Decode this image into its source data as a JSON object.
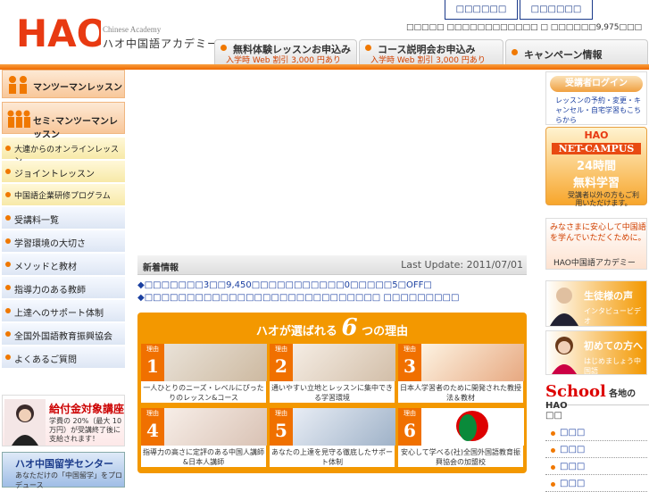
{
  "header": {
    "logo_text": "HAO",
    "logo_en": "Chinese Academy",
    "logo_ja": "ハオ中国語アカデミー",
    "top_tabs": [
      "□□□□□□",
      "□□□□□□"
    ],
    "top_info": "□□□□□ □□□□□□□□□□□□ □ □□□□□□9,975□□□",
    "nav": [
      {
        "title": "無料体験レッスンお申込み",
        "sub": "入学時 Web 割引 3,000 円あり"
      },
      {
        "title": "コース説明会お申込み",
        "sub": "入学時 Web 割引 3,000 円あり"
      },
      {
        "title": "キャンペーン情報",
        "sub": ""
      }
    ]
  },
  "sidebar": {
    "items": [
      "マンツーマンレッスン",
      "セミ･マンツーマンレッスン",
      "大連からのオンラインレッスン",
      "ジョイントレッスン",
      "中国語企業研修プログラム",
      "受講料一覧",
      "学習環境の大切さ",
      "メソッドと教材",
      "指導力のある教師",
      "上達へのサポート体制",
      "全国外国語教育振興協会",
      "よくあるご質問"
    ],
    "banner1_title": "給付金対象講座",
    "banner1_sub": "学費の 20%（最大 10万円）が受講終了後に支給されます！",
    "banner2_title": "ハオ中国留学センター",
    "banner2_sub": "あなただけの「中国留学」をプロデュース"
  },
  "main": {
    "news_title": "新着情報",
    "news_date": "Last Update: 2011/07/01",
    "news": [
      "◆□□□□□□□3□□9,450□□□□□□□□□□□0□□□□□5□OFF□",
      "◆□□□□□□□□□□□□□□□□□□□□□□□□□□□□ □□□□□□□□□"
    ],
    "reasons_title": "ハオが選ばれる",
    "reasons_num": "6",
    "reasons_suffix": "つの理由",
    "reason_label": "理由",
    "reasons": [
      {
        "n": "1",
        "caption": "一人ひとりのニーズ・レベルにぴったりのレッスン&コース"
      },
      {
        "n": "2",
        "caption": "通いやすい立地とレッスンに集中できる学習環境"
      },
      {
        "n": "3",
        "caption": "日本人学習者のために開発された教授法＆教材"
      },
      {
        "n": "4",
        "caption": "指導力の高さに定評のある中国人講師&日本人講師"
      },
      {
        "n": "5",
        "caption": "あなたの上達を見守る徹底したサポート体制"
      },
      {
        "n": "6",
        "caption": "安心して学べる(社)全国外国語教育振興協会の加盟校"
      }
    ]
  },
  "right": {
    "login_title": "受講者ログイン",
    "login_desc": "レッスンの予約・変更・キャンセル・自宅学習もこちらから",
    "netcampus_logo": "HAO",
    "netcampus_title": "NET-CAMPUS",
    "netcampus_hours": "24時間",
    "netcampus_free": "無料学習",
    "netcampus_note": "受講者以外の方もご利用いただけます。",
    "promo_text": "みなさまに安心して中国語を学んでいただくために。",
    "promo_sign": "HAO中国語アカデミー",
    "voice_title": "生徒様の声",
    "voice_sub": "インタビュービデオ",
    "first_title": "初めての方へ",
    "first_sub": "はじめましょう中国語",
    "school_big": "School",
    "school_small": "各地のHAO",
    "school_label": "□□",
    "schools": [
      "□□□",
      "□□□",
      "□□□",
      "□□□"
    ]
  },
  "colors": {
    "orange": "#f39800",
    "navy": "#1a3a8a",
    "link": "#1a3fa0"
  }
}
